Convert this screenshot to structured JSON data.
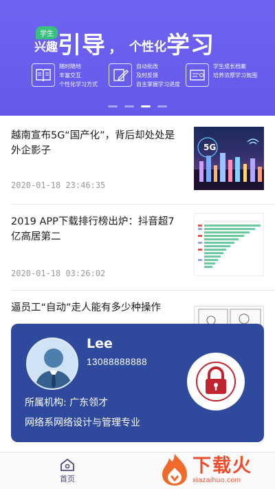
{
  "banner": {
    "tag": "学生",
    "headline": {
      "part1": "兴趣",
      "part2": "引导",
      "part3": "，",
      "part4": "个性化",
      "part5": "学习"
    },
    "features": [
      {
        "icon": "book-icon",
        "lines": [
          "随时随地",
          "丰富交互",
          "个性化学习方式"
        ]
      },
      {
        "icon": "edit-icon",
        "lines": [
          "自动批改",
          "及时反馈",
          "自主掌握学习进度"
        ]
      },
      {
        "icon": "archive-icon",
        "lines": [
          "学生成长档案",
          "培养浓厚学习氛围"
        ]
      }
    ],
    "slide_count": 4,
    "active_slide": 3
  },
  "news": [
    {
      "title": "越南宣布5G“国产化”，背后却处处是外企影子",
      "time": "2020-01-18 23:46:35",
      "thumb_text": "5G"
    },
    {
      "title": "2019 APP下载排行榜出炉：抖音超7亿高居第二",
      "time": "2020-01-18 03:26:02"
    },
    {
      "title": "逼员工“自动”走人能有多少种操作"
    }
  ],
  "profile": {
    "name": "Lee",
    "phone": "13088888888",
    "org": "所属机构: 广东领才",
    "major": "网络系网络设计与管理专业"
  },
  "nav": {
    "home": "首页"
  },
  "watermark": {
    "main": "下载火",
    "sub": "xiazaihuo.com"
  },
  "colors": {
    "banner": "#6f63f2",
    "card": "#2f4a9c",
    "lock": "#c0252f",
    "watermark": "#ee4d2d"
  }
}
